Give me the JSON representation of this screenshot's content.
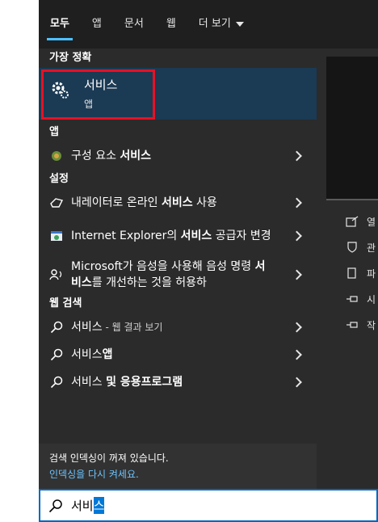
{
  "tabs": [
    {
      "label": "모두",
      "active": true
    },
    {
      "label": "앱"
    },
    {
      "label": "문서"
    },
    {
      "label": "웹"
    },
    {
      "label": "더 보기"
    }
  ],
  "best_match": {
    "section": "가장 정확",
    "title": "서비스",
    "subtitle": "앱"
  },
  "apps": {
    "section": "앱",
    "items": [
      {
        "pre": "구성 요소 ",
        "bold": "서비스",
        "post": ""
      }
    ]
  },
  "settings": {
    "section": "설정",
    "items": [
      {
        "pre": "내레이터로 온라인 ",
        "bold": "서비스",
        "post": " 사용"
      },
      {
        "pre": "Internet Explorer의 ",
        "bold": "서비스",
        "post": " 공급자 변경"
      },
      {
        "pre": "Microsoft가 음성을 사용해 음성 명령 ",
        "bold": "서비스",
        "post": "를 개선하는 것을 허용하"
      }
    ]
  },
  "web": {
    "section": "웹 검색",
    "items": [
      {
        "pre": "서비스",
        "small": " - 웹 결과 보기",
        "bold": "",
        "post": ""
      },
      {
        "pre": "서비스",
        "bold": "앱",
        "post": ""
      },
      {
        "pre": "서비스 ",
        "bold": "및 응용프로그램",
        "post": ""
      }
    ]
  },
  "notice": {
    "line1": "검색 인덱싱이 꺼져 있습니다.",
    "line2": "인덱싱을 다시 켜세요."
  },
  "preview_actions": [
    {
      "label": "열",
      "icon": "open-icon"
    },
    {
      "label": "관",
      "icon": "shield-icon"
    },
    {
      "label": "파",
      "icon": "file-icon"
    },
    {
      "label": "시",
      "icon": "pin-start-icon"
    },
    {
      "label": "작",
      "icon": "pin-taskbar-icon"
    }
  ],
  "search": {
    "typed": "서비",
    "selected": "스"
  },
  "colors": {
    "accent": "#4cc2ff",
    "best_bg": "#1b3a54",
    "highlight_box": "#e81123",
    "search_border": "#0067c0",
    "link": "#6cc4ff"
  }
}
